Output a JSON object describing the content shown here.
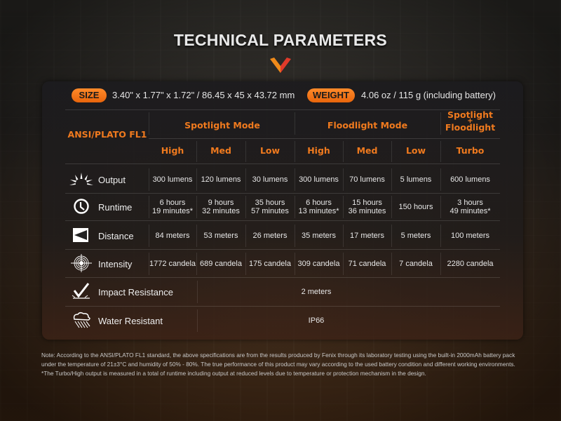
{
  "title": "TECHNICAL PARAMETERS",
  "colors": {
    "accent": "#f07a1e",
    "pill": "#e8650c",
    "text": "#e8e8e8"
  },
  "specs": {
    "size_label": "SIZE",
    "size_value": "3.40\" x 1.77\" x 1.72\" / 86.45 x 45 x 43.72 mm",
    "weight_label": "WEIGHT",
    "weight_value": "4.06 oz / 115 g (including battery)"
  },
  "table": {
    "standard": "ANSI/PLATO FL1",
    "groups": {
      "spotlight": "Spotlight Mode",
      "floodlight": "Floodlight Mode",
      "combo_line1": "Spotlight",
      "combo_plus": "+",
      "combo_line2": "Floodlight"
    },
    "modes": [
      "High",
      "Med",
      "Low",
      "High",
      "Med",
      "Low",
      "Turbo"
    ],
    "rows": [
      {
        "icon": "sunburst-icon",
        "label": "Output",
        "values": [
          [
            "300 lumens"
          ],
          [
            "120 lumens"
          ],
          [
            "30 lumens"
          ],
          [
            "300 lumens"
          ],
          [
            "70 lumens"
          ],
          [
            "5 lumens"
          ],
          [
            "600 lumens"
          ]
        ]
      },
      {
        "icon": "clock-icon",
        "label": "Runtime",
        "values": [
          [
            "6 hours",
            "19 minutes*"
          ],
          [
            "9 hours",
            "32 minutes"
          ],
          [
            "35 hours",
            "57 minutes"
          ],
          [
            "6 hours",
            "13 minutes*"
          ],
          [
            "15 hours",
            "36 minutes"
          ],
          [
            "150 hours"
          ],
          [
            "3 hours",
            "49 minutes*"
          ]
        ]
      },
      {
        "icon": "beam-distance-icon",
        "label": "Distance",
        "values": [
          [
            "84 meters"
          ],
          [
            "53 meters"
          ],
          [
            "26 meters"
          ],
          [
            "35 meters"
          ],
          [
            "17 meters"
          ],
          [
            "5 meters"
          ],
          [
            "100 meters"
          ]
        ]
      },
      {
        "icon": "target-icon",
        "label": "Intensity",
        "values": [
          [
            "1772 candela"
          ],
          [
            "689 candela"
          ],
          [
            "175 candela"
          ],
          [
            "309 candela"
          ],
          [
            "71 candela"
          ],
          [
            "7 candela"
          ],
          [
            "2280 candela"
          ]
        ]
      }
    ],
    "wide_rows": [
      {
        "icon": "impact-check-icon",
        "label": "Impact Resistance",
        "value": "2 meters"
      },
      {
        "icon": "rain-cloud-icon",
        "label": "Water Resistant",
        "value": "IP66"
      }
    ]
  },
  "note": {
    "line1": "Note: According to the ANSI/PLATO FL1 standard, the above specifications are from the results produced by Fenix through its laboratory testing using the built-in 2000mAh battery pack",
    "line2": "under the temperature of 21±3°C and humidity of 50% - 80%. The true performance of this product may vary according to the used battery condition and different working environments.",
    "line3": "*The Turbo/High output is measured in a total of runtime including output at reduced levels due to temperature or protection mechanism in the design."
  }
}
